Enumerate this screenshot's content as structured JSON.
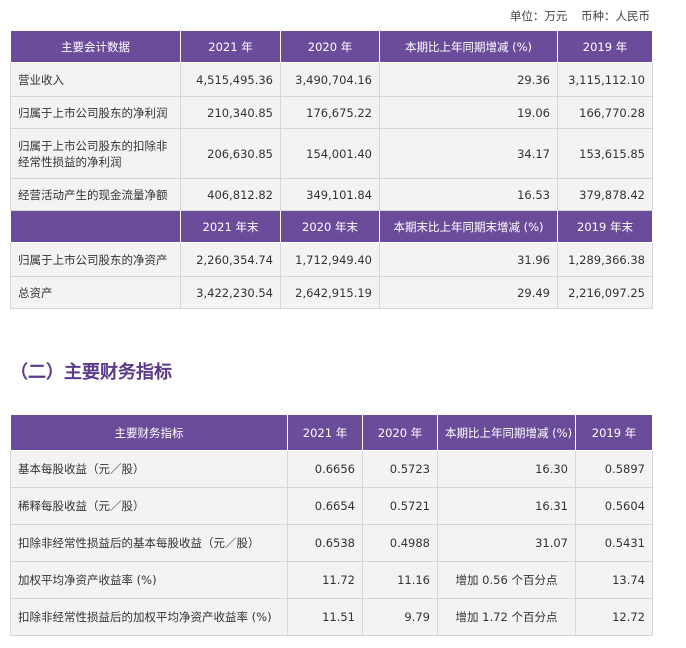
{
  "unit": {
    "unit_label": "单位：万元",
    "currency_label": "币种：人民币"
  },
  "table1": {
    "header": [
      "主要会计数据",
      "2021 年",
      "2020 年",
      "本期比上年同期增减 (%)",
      "2019 年"
    ],
    "rows": [
      [
        "营业收入",
        "4,515,495.36",
        "3,490,704.16",
        "29.36",
        "3,115,112.10"
      ],
      [
        "归属于上市公司股东的净利润",
        "210,340.85",
        "176,675.22",
        "19.06",
        "166,770.28"
      ],
      [
        "归属于上市公司股东的扣除非经常性损益的净利润",
        "206,630.85",
        "154,001.40",
        "34.17",
        "153,615.85"
      ],
      [
        "经营活动产生的现金流量净额",
        "406,812.82",
        "349,101.84",
        "16.53",
        "379,878.42"
      ]
    ],
    "header2": [
      "",
      "2021 年末",
      "2020 年末",
      "本期末比上年同期末增减 (%)",
      "2019 年末"
    ],
    "rows2": [
      [
        "归属于上市公司股东的净资产",
        "2,260,354.74",
        "1,712,949.40",
        "31.96",
        "1,289,366.38"
      ],
      [
        "总资产",
        "3,422,230.54",
        "2,642,915.19",
        "29.49",
        "2,216,097.25"
      ]
    ]
  },
  "section_title": "（二）主要财务指标",
  "table2": {
    "header": [
      "主要财务指标",
      "2021 年",
      "2020 年",
      "本期比上年同期增减 (%)",
      "2019 年"
    ],
    "rows": [
      [
        "基本每股收益（元／股）",
        "0.6656",
        "0.5723",
        "16.30",
        "0.5897"
      ],
      [
        "稀释每股收益（元／股）",
        "0.6654",
        "0.5721",
        "16.31",
        "0.5604"
      ],
      [
        "扣除非经常性损益后的基本每股收益（元／股）",
        "0.6538",
        "0.4988",
        "31.07",
        "0.5431"
      ],
      [
        "加权平均净资产收益率 (%)",
        "11.72",
        "11.16",
        "增加 0.56 个百分点",
        "13.74"
      ],
      [
        "扣除非经常性损益后的加权平均净资产收益率 (%)",
        "11.51",
        "9.79",
        "增加 1.72 个百分点",
        "12.72"
      ]
    ]
  }
}
